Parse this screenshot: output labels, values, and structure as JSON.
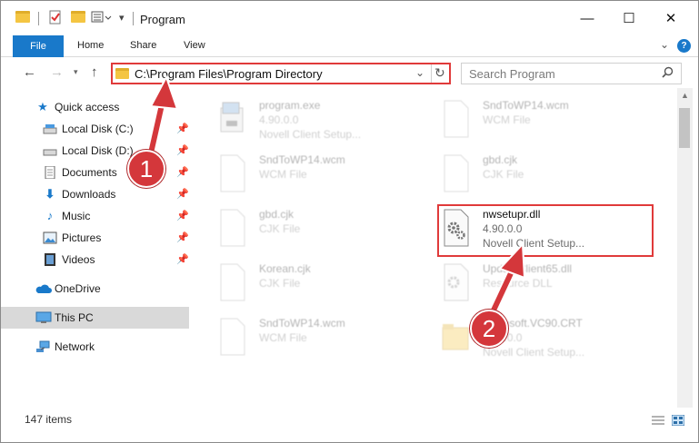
{
  "window": {
    "title": "Program",
    "controls": {
      "minimize": "—",
      "maximize": "☐",
      "close": "✕"
    }
  },
  "ribbon": {
    "file_tab": "File",
    "tabs": [
      "Home",
      "Share",
      "View"
    ],
    "help": "?"
  },
  "navigation": {
    "back_icon": "back-arrow-icon",
    "forward_icon": "forward-arrow-icon",
    "up_icon": "up-arrow-icon",
    "address_path": "C:\\Program Files\\Program Directory",
    "search_placeholder": "Search Program"
  },
  "sidebar": {
    "items": [
      {
        "label": "Quick access",
        "icon": "star-icon",
        "pinned": false
      },
      {
        "label": "Local Disk (C:)",
        "icon": "drive-icon",
        "pinned": true
      },
      {
        "label": "Local Disk (D:)",
        "icon": "drive-icon",
        "pinned": true
      },
      {
        "label": "Documents",
        "icon": "documents-icon",
        "pinned": true
      },
      {
        "label": "Downloads",
        "icon": "download-icon",
        "pinned": true
      },
      {
        "label": "Music",
        "icon": "music-icon",
        "pinned": true
      },
      {
        "label": "Pictures",
        "icon": "pictures-icon",
        "pinned": true
      },
      {
        "label": "Videos",
        "icon": "videos-icon",
        "pinned": true
      },
      {
        "label": "OneDrive",
        "icon": "cloud-icon",
        "pinned": false
      },
      {
        "label": "This PC",
        "icon": "computer-icon",
        "pinned": false
      },
      {
        "label": "Network",
        "icon": "network-icon",
        "pinned": false
      }
    ]
  },
  "files": [
    {
      "name": "program.exe",
      "line2": "4.90.0.0",
      "line3": "Novell Client Setup...",
      "icon": "exe-icon"
    },
    {
      "name": "SndToWP14.wcm",
      "line2": "WCM File",
      "line3": "",
      "icon": "document-icon"
    },
    {
      "name": "SndToWP14.wcm",
      "line2": "WCM File",
      "line3": "",
      "icon": "document-icon"
    },
    {
      "name": "gbd.cjk",
      "line2": "CJK File",
      "line3": "",
      "icon": "document-icon"
    },
    {
      "name": "gbd.cjk",
      "line2": "CJK File",
      "line3": "",
      "icon": "document-icon"
    },
    {
      "name": "nwsetupr.dll",
      "line2": "4.90.0.0",
      "line3": "Novell Client Setup...",
      "icon": "dll-gear-icon"
    },
    {
      "name": "Korean.cjk",
      "line2": "CJK File",
      "line3": "",
      "icon": "document-icon"
    },
    {
      "name": "UpdateClient65.dll",
      "line2": "Resource DLL",
      "line3": "",
      "icon": "dll-gear-icon"
    },
    {
      "name": "SndToWP14.wcm",
      "line2": "WCM File",
      "line3": "",
      "icon": "document-icon"
    },
    {
      "name": "Microsoft.VC90.CRT",
      "line2": "4.90.0.0",
      "line3": "Novell Client Setup...",
      "icon": "folder-icon"
    }
  ],
  "status": {
    "item_count": "147 items"
  },
  "annotations": {
    "step1": "1",
    "step2": "2"
  },
  "colors": {
    "accent": "#1979ca",
    "highlight": "#e03a3a",
    "badge": "#d4373b",
    "folder": "#f4c542"
  }
}
